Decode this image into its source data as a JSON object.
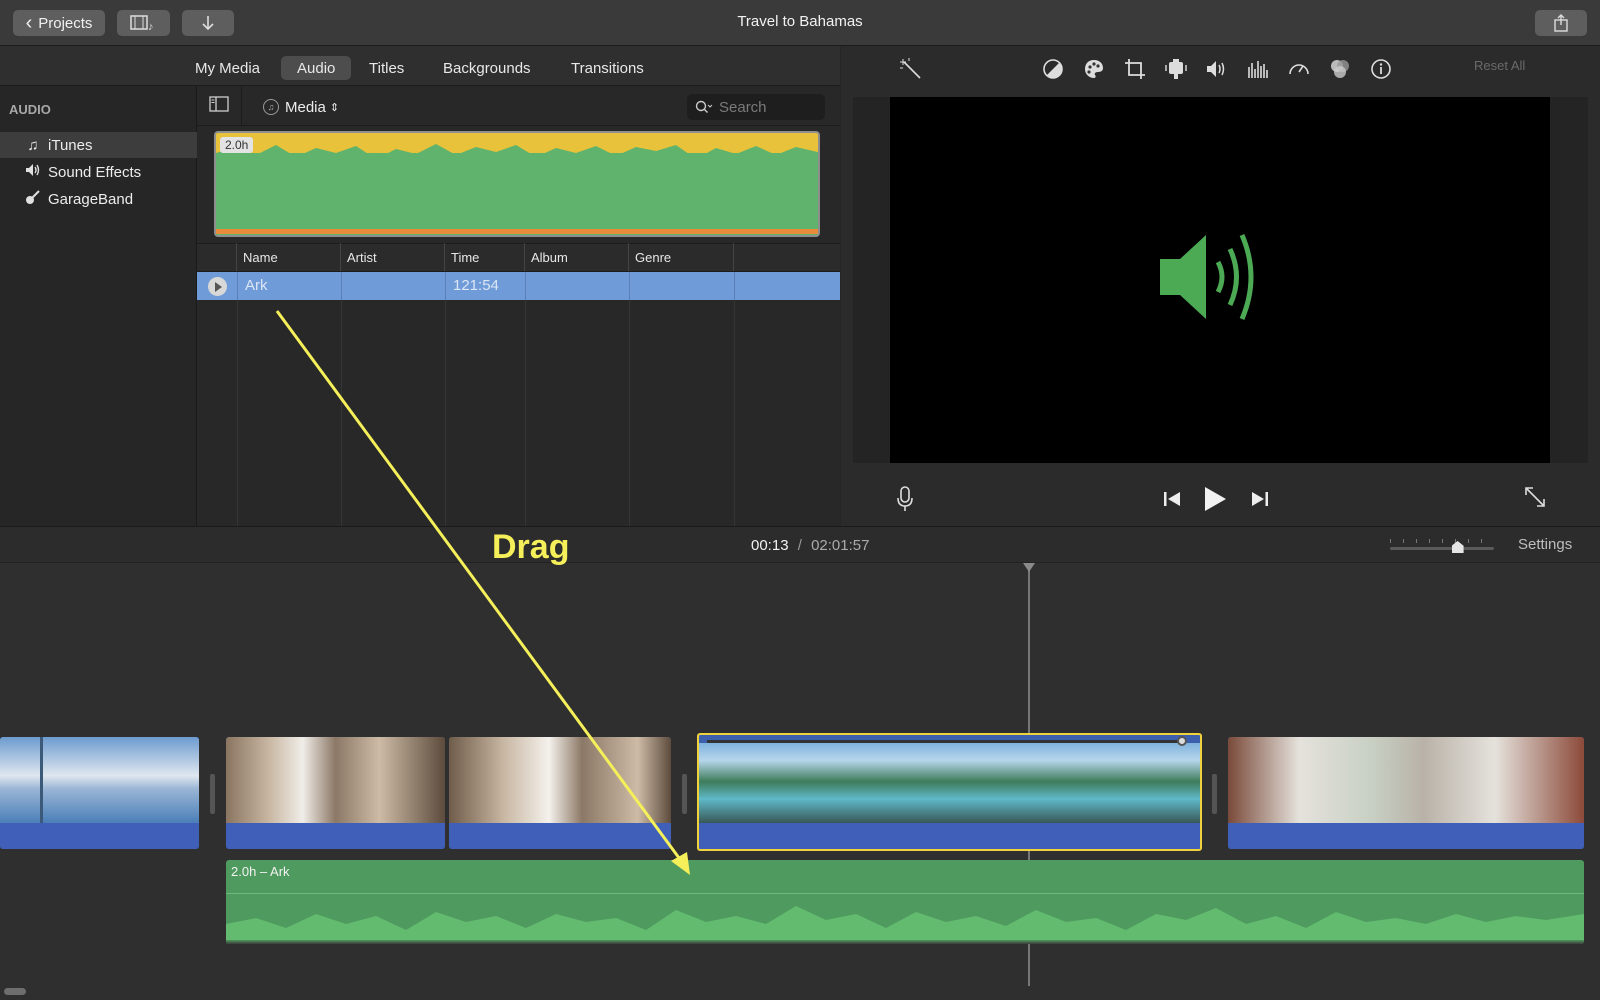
{
  "window": {
    "title": "Travel to Bahamas",
    "projects_label": "Projects",
    "projects_chevron": "‹"
  },
  "tabs": [
    "My Media",
    "Audio",
    "Titles",
    "Backgrounds",
    "Transitions"
  ],
  "sidebar": {
    "title": "AUDIO",
    "items": [
      {
        "label": "iTunes",
        "icon": "music-note-icon",
        "glyph": "♫"
      },
      {
        "label": "Sound Effects",
        "icon": "speaker-icon",
        "glyph": "🔊"
      },
      {
        "label": "GarageBand",
        "icon": "guitar-icon",
        "glyph": "♪"
      }
    ]
  },
  "browser": {
    "source_label": "Media",
    "search_placeholder": "Search",
    "thumb_badge": "2.0h",
    "columns": [
      "Name",
      "Artist",
      "Time",
      "Album",
      "Genre"
    ],
    "rows": [
      {
        "name": "Ark",
        "artist": "",
        "time": "121:54",
        "album": "",
        "genre": ""
      }
    ]
  },
  "viewer": {
    "reset_all": "Reset All",
    "tools": [
      "magic-wand-icon",
      "color-balance-icon",
      "color-correction-icon",
      "crop-icon",
      "stabilization-icon",
      "volume-icon",
      "noise-reduction-icon",
      "speed-icon",
      "clip-filter-icon",
      "info-icon"
    ]
  },
  "timeline": {
    "current_time": "00:13",
    "separator": "/",
    "total_time": "02:01:57",
    "settings_label": "Settings",
    "zoom_level": 0.65,
    "music_clip_label": "2.0h – Ark"
  },
  "annotation": {
    "drag_label": "Drag",
    "color": "#f5f05a"
  },
  "colors": {
    "accent_selection": "#6f9bd8",
    "audio_green": "#4f9a5f",
    "waveform_yellow": "#e8c23a",
    "clip_audio_blue": "#3f5fb8",
    "selected_clip_border": "#f2d23c"
  }
}
